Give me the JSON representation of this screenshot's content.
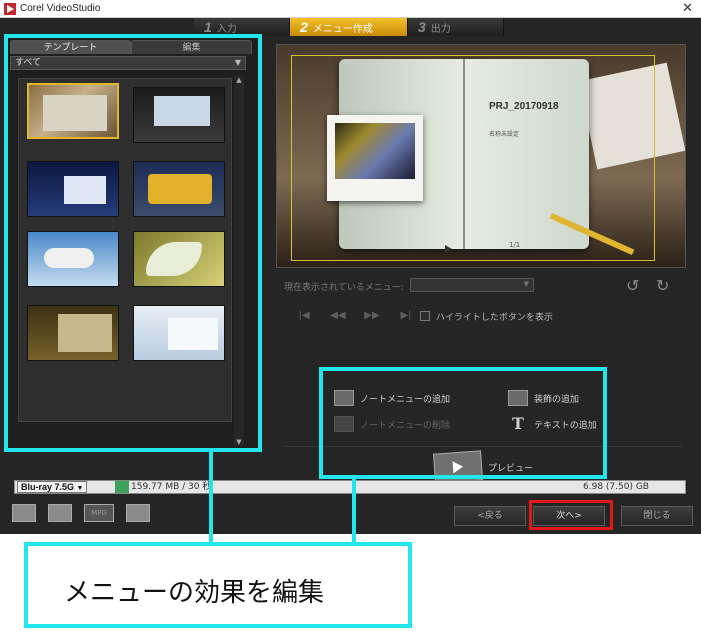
{
  "window": {
    "title": "Corel VideoStudio",
    "close_glyph": "✕"
  },
  "steps": [
    {
      "num": "1",
      "label": "入力"
    },
    {
      "num": "2",
      "label": "メニュー作成"
    },
    {
      "num": "3",
      "label": "出力"
    }
  ],
  "left_panel": {
    "tabs": [
      "テンプレート",
      "編集"
    ],
    "filter": "すべて",
    "thumbnails": [
      {
        "name": "template-book",
        "selected": true
      },
      {
        "name": "template-dark-frame",
        "selected": false
      },
      {
        "name": "template-night",
        "selected": false
      },
      {
        "name": "template-bus",
        "selected": false
      },
      {
        "name": "template-plane",
        "selected": false
      },
      {
        "name": "template-leaf",
        "selected": false
      },
      {
        "name": "template-gold",
        "selected": false
      },
      {
        "name": "template-light-blue",
        "selected": false
      }
    ]
  },
  "preview": {
    "project_title": "PRJ_20170918",
    "subtitle": "名称未設定",
    "page": "1/1"
  },
  "controls": {
    "current_menu_label": "現在表示されているメニュー:",
    "highlight_label": "ハイライトしたボタンを表示",
    "highlight_checked": false
  },
  "actions": {
    "add_note_menu": "ノートメニューの追加",
    "delete_note_menu": "ノートメニューの削除",
    "add_decoration": "装飾の追加",
    "add_text": "テキストの追加",
    "preview": "プレビュー"
  },
  "bottom": {
    "disc_type": "Blu-ray 7.5G",
    "used": "159.77 MB / 30 秒",
    "total": "6.98 (7.50) GB",
    "back": "<戻る",
    "next": "次へ>",
    "close": "閉じる"
  },
  "annotation": {
    "callout": "メニューの効果を編集"
  },
  "colors": {
    "highlight": "#22e6ec",
    "next_box": "#e01818",
    "active_step": "#f3c02a"
  }
}
